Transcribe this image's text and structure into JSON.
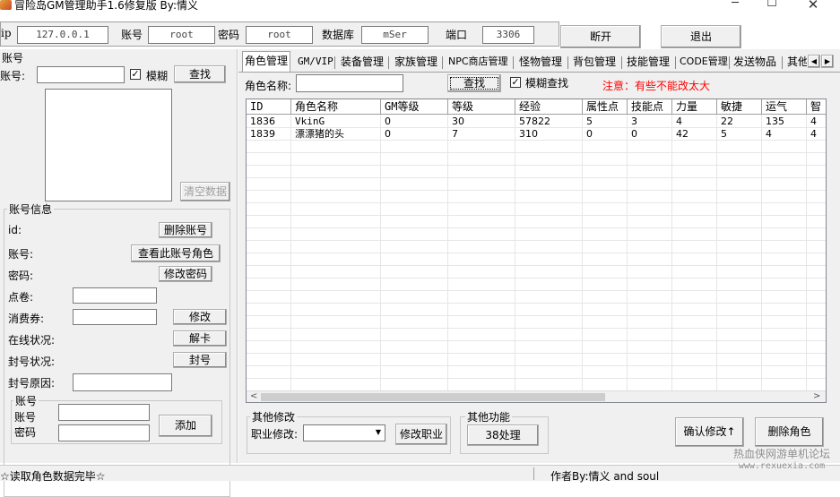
{
  "window": {
    "title": "冒险岛GM管理助手1.6修复版 By:情义",
    "min": "─",
    "max": "☐",
    "close": "✕"
  },
  "connection": {
    "ip_label": "ip",
    "ip_value": "127.0.0.1",
    "account_label": "账号",
    "account_value": "root",
    "password_label": "密码",
    "password_value": "root",
    "database_label": "数据库",
    "database_value": "mSer",
    "port_label": "端口",
    "port_value": "3306",
    "disconnect_label": "断开",
    "exit_label": "退出"
  },
  "account_search": {
    "section_label": "账号",
    "account_label": "账号:",
    "fuzzy_label": "模糊",
    "fuzzy_checked": "✓",
    "search_label": "查找",
    "clear_label": "清空数据"
  },
  "account_info": {
    "title": "账号信息",
    "id_label": "id:",
    "delete_account_label": "删除账号",
    "account_label": "账号:",
    "view_roles_label": "查看此账号角色",
    "password_label": "密码:",
    "change_password_label": "修改密码",
    "points_label": "点卷:",
    "voucher_label": "消费券:",
    "modify_label": "修改",
    "online_label": "在线状况:",
    "unstuck_label": "解卡",
    "ban_status_label": "封号状况:",
    "ban_label": "封号",
    "ban_reason_label": "封号原因:"
  },
  "new_account": {
    "title": "账号",
    "account_label": "账号",
    "password_label": "密码",
    "add_label": "添加"
  },
  "tabs": [
    {
      "label": "角色管理"
    },
    {
      "label": "GM/VIP"
    },
    {
      "label": "装备管理"
    },
    {
      "label": "家族管理"
    },
    {
      "label": "NPC商店管理"
    },
    {
      "label": "怪物管理"
    },
    {
      "label": "背包管理"
    },
    {
      "label": "技能管理"
    },
    {
      "label": "CODE管理"
    },
    {
      "label": "发送物品"
    },
    {
      "label": "其他"
    }
  ],
  "role_search": {
    "name_label": "角色名称:",
    "search_label": "查找",
    "fuzzy_label": "模糊查找",
    "fuzzy_checked": "✓",
    "notice": "注意：有些不能改太大",
    "notice_color": "#ff0000"
  },
  "grid": {
    "columns": [
      "ID",
      "角色名称",
      "GM等级",
      "等级",
      "经验",
      "属性点",
      "技能点",
      "力量",
      "敏捷",
      "运气",
      "智"
    ],
    "rows": [
      [
        "1836",
        "VkinG",
        "0",
        "30",
        "57822",
        "5",
        "3",
        "4",
        "22",
        "135",
        "4"
      ],
      [
        "1839",
        "漂漂猪的头",
        "0",
        "7",
        "310",
        "0",
        "0",
        "42",
        "5",
        "4",
        "4"
      ]
    ]
  },
  "other_modify": {
    "title": "其他修改",
    "job_label": "职业修改:",
    "modify_job_label": "修改职业"
  },
  "other_function": {
    "title": "其他功能",
    "process_label": "38处理"
  },
  "actions": {
    "confirm_label": "确认修改↑",
    "delete_role_label": "删除角色"
  },
  "status": {
    "left_text": "☆读取角色数据完毕☆",
    "author_text": "作者By:情义 and soul",
    "watermark_line1": "热血侠网游单机论坛",
    "watermark_line2": "www.rexuexia.com"
  },
  "colors": {
    "window_bg": "#f0f0f0",
    "notice_red": "#ff0000"
  }
}
